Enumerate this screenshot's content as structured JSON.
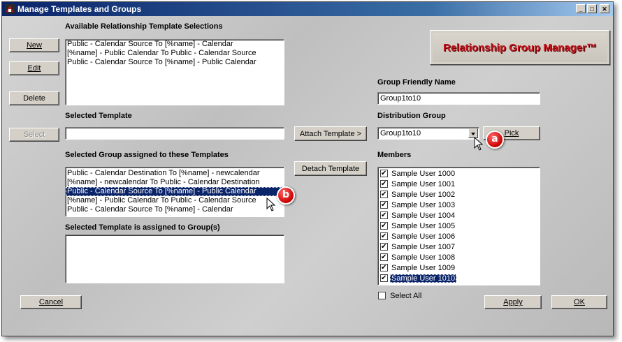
{
  "window": {
    "title": "Manage Templates and Groups",
    "controls": {
      "minimize": "_",
      "maximize": "□",
      "close": "✕"
    }
  },
  "labels": {
    "available": "Available Relationship Template Selections",
    "selected_template": "Selected Template",
    "selected_group": "Selected Group assigned to these Templates",
    "template_assigned": "Selected Template is assigned  to Group(s)",
    "friendly_name": "Group Friendly Name",
    "distribution_group": "Distribution Group",
    "members": "Members",
    "select_all": "Select All"
  },
  "buttons": {
    "new": "New",
    "edit": "Edit",
    "delete": "Delete",
    "select": "Select",
    "attach": "Attach Template >",
    "detach": "Detach Template",
    "pick": "Pick",
    "cancel": "Cancel",
    "apply": "Apply",
    "ok": "OK"
  },
  "logo_text": "Relationship Group Manager™",
  "available_templates": [
    "Public - Calendar Source To [%name] - Calendar",
    "[%name] - Public Calendar To Public - Calendar Source",
    "Public - Calendar Source To [%name] - Public Calendar"
  ],
  "selected_template_value": "",
  "group_templates": [
    "Public - Calendar Destination To [%name] - newcalendar",
    "[%name] - newcalendar To Public - Calendar Destination",
    "Public - Calendar Source To [%name] - Public Calendar",
    "[%name] - Public Calendar To Public - Calendar Source",
    "Public - Calendar Source To [%name] - Calendar"
  ],
  "group_templates_selected_index": 2,
  "friendly_name_value": "Group1to10",
  "distribution_group_value": "Group1to10",
  "members": [
    "Sample User 1000",
    "Sample User 1001",
    "Sample User 1002",
    "Sample User 1003",
    "Sample User 1004",
    "Sample User 1005",
    "Sample User 1006",
    "Sample User 1007",
    "Sample User 1008",
    "Sample User 1009",
    "Sample User 1010"
  ],
  "members_selected_index": 10,
  "select_all_checked": false,
  "callouts": {
    "a": "a",
    "b": "b"
  },
  "icons": {
    "app": "app-icon",
    "cursor": "mouse-cursor-icon"
  }
}
